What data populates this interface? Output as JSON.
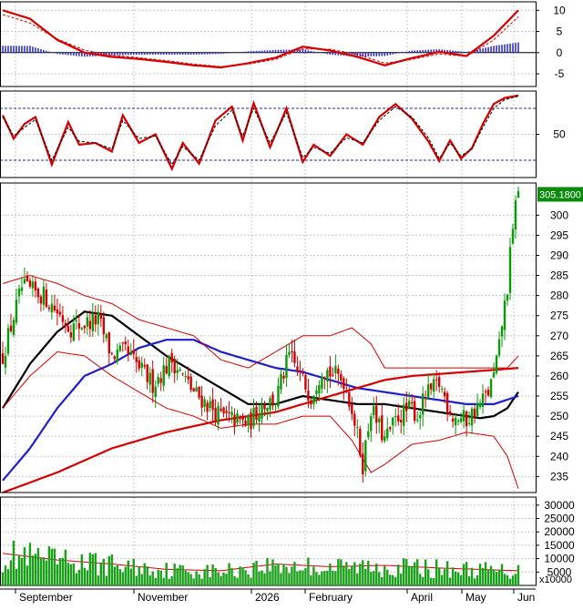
{
  "chart_data": {
    "type": "candlestick",
    "price_badge": "305.1800",
    "x_labels": [
      "September",
      "November",
      "2026",
      "February",
      "April",
      "May",
      "Jun"
    ],
    "volume_unit": "x10000",
    "panels": [
      {
        "name": "macd",
        "ylim": [
          -8,
          12
        ],
        "ticks": [
          10,
          5,
          0,
          -5
        ],
        "series": [
          {
            "role": "macd",
            "color": "#d40000",
            "x": [
              0,
              10,
              20,
              30,
              40,
              50,
              60,
              70,
              80,
              90,
              100,
              110,
              120,
              130,
              140,
              150,
              160,
              170,
              180,
              189
            ],
            "values": [
              10,
              8,
              3,
              0,
              -1,
              -1.5,
              -2.2,
              -3,
              -3.5,
              -2.5,
              -1.2,
              1.4,
              0.5,
              -1,
              -3,
              -1.3,
              0.2,
              -0.8,
              4,
              10
            ]
          },
          {
            "role": "signal",
            "color": "#d40000",
            "dashed": true,
            "x": [
              0,
              10,
              20,
              30,
              40,
              50,
              60,
              70,
              80,
              90,
              100,
              110,
              120,
              130,
              140,
              150,
              160,
              170,
              180,
              189
            ],
            "values": [
              9,
              7,
              3.2,
              0.6,
              -0.6,
              -1.2,
              -1.9,
              -2.7,
              -3.3,
              -2.7,
              -1.6,
              0.9,
              0.8,
              -0.4,
              -2.5,
              -1.6,
              -0.3,
              -0.9,
              3,
              8.5
            ]
          }
        ]
      },
      {
        "name": "stochastic",
        "ylim": [
          0,
          100
        ],
        "ticks": [
          50
        ],
        "levels": [
          80,
          20
        ],
        "series": [
          {
            "role": "k",
            "color": "#d40000",
            "x": [
              0,
              4,
              8,
              12,
              18,
              24,
              28,
              34,
              40,
              44,
              50,
              56,
              62,
              66,
              72,
              78,
              84,
              88,
              92,
              98,
              104,
              110,
              114,
              120,
              126,
              132,
              138,
              144,
              150,
              156,
              160,
              164,
              168,
              172,
              176,
              180,
              184,
              189
            ],
            "values": [
              72,
              45,
              62,
              70,
              15,
              64,
              38,
              40,
              30,
              72,
              40,
              50,
              10,
              40,
              16,
              66,
              82,
              43,
              86,
              35,
              80,
              18,
              38,
              25,
              50,
              38,
              70,
              85,
              68,
              42,
              19,
              43,
              22,
              34,
              62,
              85,
              92,
              95
            ]
          },
          {
            "role": "d",
            "color": "#000000",
            "dashed": true,
            "x": [
              0,
              4,
              8,
              12,
              18,
              24,
              28,
              34,
              40,
              44,
              50,
              56,
              62,
              66,
              72,
              78,
              84,
              88,
              92,
              98,
              104,
              110,
              114,
              120,
              126,
              132,
              138,
              144,
              150,
              156,
              160,
              164,
              168,
              172,
              176,
              180,
              184,
              189
            ],
            "values": [
              70,
              48,
              58,
              67,
              20,
              58,
              42,
              40,
              33,
              66,
              45,
              48,
              15,
              36,
              20,
              60,
              78,
              48,
              80,
              40,
              75,
              23,
              35,
              28,
              46,
              40,
              66,
              82,
              70,
              46,
              22,
              40,
              25,
              33,
              58,
              80,
              90,
              94
            ]
          }
        ]
      },
      {
        "name": "price",
        "ylim": [
          231,
          308
        ],
        "ticks": [
          300,
          295,
          290,
          285,
          280,
          275,
          270,
          265,
          260,
          255,
          250,
          245,
          240,
          235
        ],
        "series": [
          {
            "role": "ma-short",
            "color": "#000000",
            "x": [
              0,
              10,
              20,
              30,
              40,
              50,
              60,
              70,
              80,
              90,
              100,
              110,
              120,
              130,
              140,
              150,
              160,
              170,
              175,
              180,
              185,
              189
            ],
            "values": [
              252,
              263,
              271,
              276,
              275,
              270,
              265,
              261,
              257,
              253,
              253,
              255,
              254,
              253,
              253,
              252,
              251,
              250,
              249.5,
              250,
              252,
              256
            ]
          },
          {
            "role": "ma-medium",
            "color": "#1f1fc9",
            "x": [
              0,
              10,
              20,
              30,
              40,
              50,
              60,
              70,
              80,
              90,
              100,
              110,
              120,
              130,
              140,
              150,
              160,
              170,
              180,
              189
            ],
            "values": [
              234,
              242,
              252,
              260,
              263,
              267,
              269,
              269,
              266,
              264,
              262,
              261,
              259,
              257,
              256,
              255,
              254,
              253,
              253,
              255
            ]
          },
          {
            "role": "ma-long",
            "color": "#d40000",
            "x": [
              0,
              20,
              40,
              60,
              80,
              100,
              120,
              130,
              140,
              150,
              160,
              170,
              180,
              189
            ],
            "values": [
              231,
              236,
              242,
              246,
              249,
              251,
              255,
              257,
              259,
              260,
              260.5,
              261,
              261.5,
              262
            ]
          },
          {
            "role": "band-upper",
            "color": "#d40000",
            "thin": true,
            "x": [
              0,
              10,
              20,
              30,
              40,
              50,
              60,
              70,
              80,
              90,
              100,
              110,
              120,
              128,
              135,
              140,
              150,
              160,
              170,
              180,
              185,
              189
            ],
            "values": [
              283,
              285,
              283,
              280,
              278,
              274,
              272,
              270,
              264,
              262,
              266,
              270,
              270,
              272,
              268,
              262,
              262,
              262,
              262,
              262,
              262,
              265
            ]
          },
          {
            "role": "band-lower",
            "color": "#d40000",
            "thin": true,
            "x": [
              0,
              10,
              20,
              30,
              40,
              50,
              60,
              70,
              80,
              90,
              100,
              110,
              120,
              128,
              135,
              140,
              150,
              160,
              170,
              180,
              185,
              189
            ],
            "values": [
              252,
              260,
              266,
              265,
              260,
              256,
              252,
              250,
              247,
              248,
              248,
              250,
              250,
              244,
              236,
              238,
              243,
              244,
              246,
              245,
              240,
              232
            ]
          }
        ],
        "candles": {
          "anchor_x": [
            0,
            7,
            15,
            25,
            35,
            40,
            45,
            55,
            62,
            70,
            80,
            90,
            95,
            100,
            105,
            113,
            117,
            125,
            128,
            132,
            135,
            140,
            145,
            150,
            152,
            155,
            160,
            165,
            170,
            175,
            178,
            180,
            182,
            183,
            185,
            186,
            187,
            188
          ],
          "anchor_close": [
            265,
            282,
            280,
            272,
            274,
            265,
            266,
            258,
            264,
            256,
            250,
            248,
            253,
            254,
            265,
            255,
            262,
            259,
            252,
            238,
            252,
            244,
            250,
            252,
            250,
            255,
            258,
            250,
            249,
            253,
            256,
            260,
            267,
            273,
            282,
            290,
            295,
            305
          ]
        }
      },
      {
        "name": "volume",
        "ylim": [
          0,
          33000
        ],
        "ticks": [
          30000,
          25000,
          20000,
          15000,
          10000,
          5000
        ],
        "ma": {
          "color": "#d40000",
          "x": [
            0,
            20,
            40,
            60,
            80,
            100,
            120,
            140,
            160,
            180,
            189
          ],
          "values": [
            12000,
            9500,
            8000,
            6000,
            5500,
            8000,
            7000,
            7500,
            6500,
            5800,
            5500
          ]
        }
      }
    ]
  },
  "colors": {
    "up": "#0a9a0a",
    "down": "#d40000",
    "badge_bg": "#0b8a0b",
    "volume_bar": "#1aa01a",
    "macd_hist": "#3333cc",
    "grid": "#c8c8c8",
    "frame": "#000000"
  }
}
